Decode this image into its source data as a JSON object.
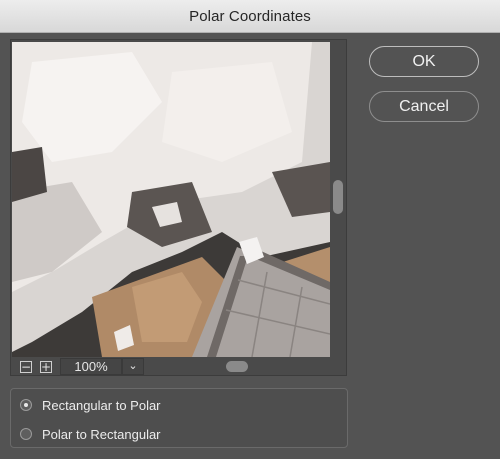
{
  "window": {
    "title": "Polar Coordinates"
  },
  "buttons": {
    "ok_label": "OK",
    "cancel_label": "Cancel"
  },
  "zoom": {
    "zoom_out_symbol": "−",
    "zoom_in_symbol": "+",
    "value": "100%",
    "dropdown_symbol": "⌄"
  },
  "options": {
    "items": [
      {
        "label": "Rectangular to Polar",
        "selected": true
      },
      {
        "label": "Polar to Rectangular",
        "selected": false
      }
    ]
  },
  "preview": {
    "icon": "photo-preview",
    "colors": {
      "foliage": "#e9e5e2",
      "dry_grass": "#b99370",
      "pavement": "#a9a3a0",
      "shadow": "#3d3a38"
    }
  }
}
